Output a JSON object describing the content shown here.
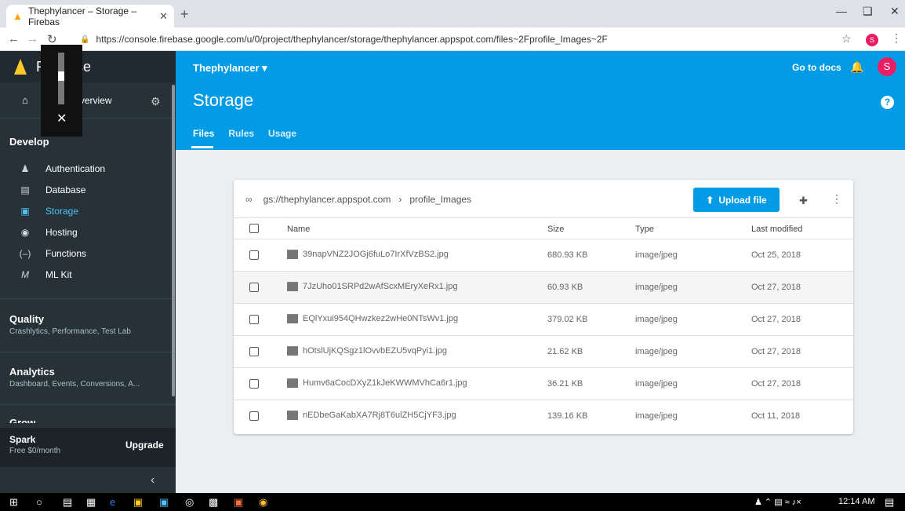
{
  "browser": {
    "tab_title": "Thephylancer – Storage – Firebas",
    "url": "https://console.firebase.google.com/u/0/project/thephylancer/storage/thephylancer.appspot.com/files~2Fprofile_Images~2F",
    "profile_letter": "S"
  },
  "sidebar": {
    "brand": "Firebase",
    "project_overview": "Project Overview",
    "develop_label": "Develop",
    "develop_items": [
      {
        "label": "Authentication",
        "icon": "people-icon"
      },
      {
        "label": "Database",
        "icon": "database-icon"
      },
      {
        "label": "Storage",
        "icon": "storage-icon"
      },
      {
        "label": "Hosting",
        "icon": "hosting-icon"
      },
      {
        "label": "Functions",
        "icon": "functions-icon"
      },
      {
        "label": "ML Kit",
        "icon": "mlkit-icon"
      }
    ],
    "quality_label": "Quality",
    "quality_sub": "Crashlytics, Performance, Test Lab",
    "analytics_label": "Analytics",
    "analytics_sub": "Dashboard, Events, Conversions, A...",
    "grow_label": "Grow",
    "plan_name": "Spark",
    "plan_price": "Free $0/month",
    "upgrade": "Upgrade"
  },
  "header": {
    "project": "Thephylancer",
    "go_to_docs": "Go to docs",
    "avatar": "S",
    "title": "Storage",
    "tabs": [
      "Files",
      "Rules",
      "Usage"
    ]
  },
  "storage": {
    "bucket": "gs://thephylancer.appspot.com",
    "folder": "profile_Images",
    "upload_label": "Upload file",
    "columns": {
      "name": "Name",
      "size": "Size",
      "type": "Type",
      "modified": "Last modified"
    },
    "files": [
      {
        "name": "39napVNZ2JOGj6fuLo7IrXfVzBS2.jpg",
        "size": "680.93 KB",
        "type": "image/jpeg",
        "modified": "Oct 25, 2018"
      },
      {
        "name": "7JzUho01SRPd2wAfScxMEryXeRx1.jpg",
        "size": "60.93 KB",
        "type": "image/jpeg",
        "modified": "Oct 27, 2018"
      },
      {
        "name": "EQlYxui954QHwzkez2wHe0NTsWv1.jpg",
        "size": "379.02 KB",
        "type": "image/jpeg",
        "modified": "Oct 27, 2018"
      },
      {
        "name": "hOtslUjKQSgz1lOvvbEZU5vqPyi1.jpg",
        "size": "21.62 KB",
        "type": "image/jpeg",
        "modified": "Oct 27, 2018"
      },
      {
        "name": "Humv6aCocDXyZ1kJeKWWMVhCa6r1.jpg",
        "size": "36.21 KB",
        "type": "image/jpeg",
        "modified": "Oct 27, 2018"
      },
      {
        "name": "nEDbeGaKabXA7Rj8T6ulZH5CjYF3.jpg",
        "size": "139.16 KB",
        "type": "image/jpeg",
        "modified": "Oct 11, 2018"
      }
    ]
  },
  "taskbar": {
    "time": "12:14 AM"
  },
  "colors": {
    "primary": "#039be5",
    "sidebar": "#263238",
    "active": "#4fc3f7",
    "avatar": "#e91e63"
  }
}
